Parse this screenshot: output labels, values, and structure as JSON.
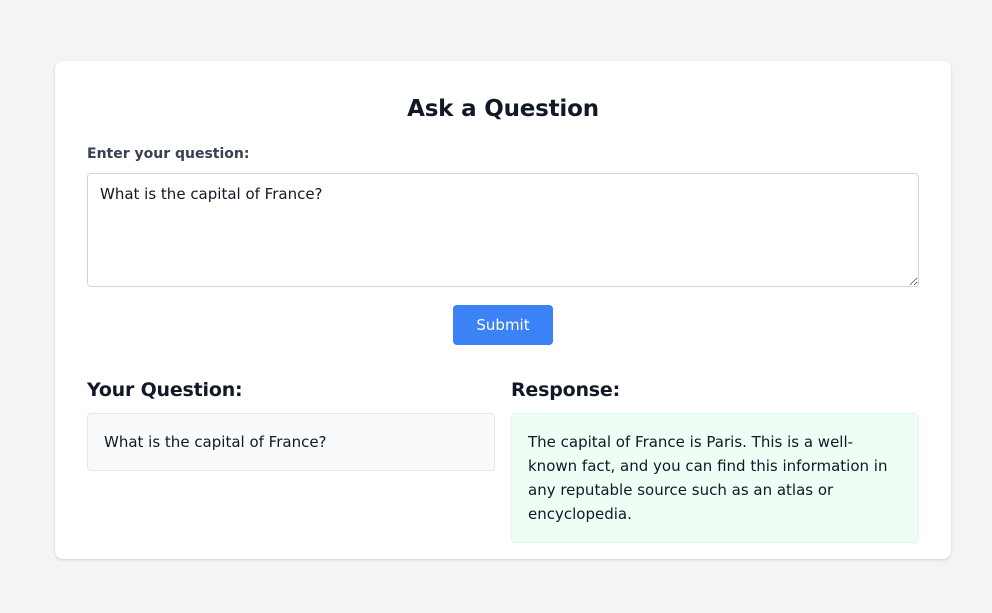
{
  "form": {
    "title": "Ask a Question",
    "field_label": "Enter your question:",
    "input_value": "What is the capital of France?",
    "submit_label": "Submit"
  },
  "results": {
    "question_heading": "Your Question:",
    "question_text": "What is the capital of France?",
    "response_heading": "Response:",
    "response_text": "The capital of France is Paris. This is a well-known fact, and you can find this information in any reputable source such as an atlas or encyclopedia."
  },
  "colors": {
    "page_background": "#f3f4f6",
    "accent": "#3b82f6",
    "question_box": "#f9fafb",
    "response_box": "#f0fdf4"
  }
}
